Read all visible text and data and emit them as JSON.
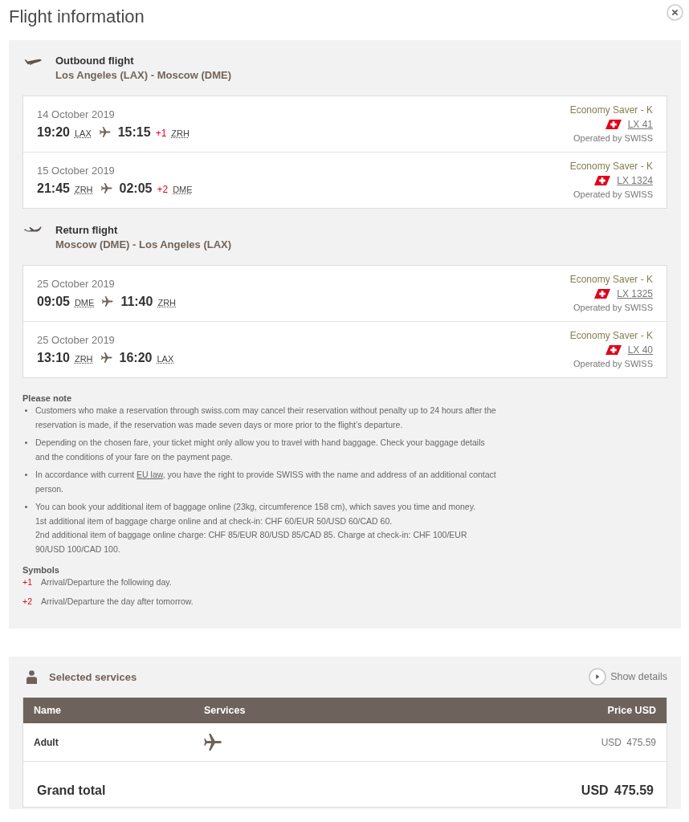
{
  "dialog": {
    "title": "Flight information"
  },
  "journeys": [
    {
      "kind": "outbound",
      "heading": "Outbound flight",
      "route": "Los Angeles (LAX) - Moscow (DME)",
      "segments": [
        {
          "date": "14 October 2019",
          "departure_time": "19:20",
          "departure_airport": "LAX",
          "arrival_time": "15:15",
          "day_offset": "+1",
          "arrival_airport": "ZRH",
          "fare": "Economy Saver - K",
          "flight_number": "LX 41",
          "operator": "Operated by SWISS"
        },
        {
          "date": "15 October 2019",
          "departure_time": "21:45",
          "departure_airport": "ZRH",
          "arrival_time": "02:05",
          "day_offset": "+2",
          "arrival_airport": "DME",
          "fare": "Economy Saver - K",
          "flight_number": "LX 1324",
          "operator": "Operated by SWISS"
        }
      ]
    },
    {
      "kind": "return",
      "heading": "Return flight",
      "route": "Moscow (DME) - Los Angeles (LAX)",
      "segments": [
        {
          "date": "25 October 2019",
          "departure_time": "09:05",
          "departure_airport": "DME",
          "arrival_time": "11:40",
          "arrival_airport": "ZRH",
          "fare": "Economy Saver - K",
          "flight_number": "LX 1325",
          "operator": "Operated by SWISS"
        },
        {
          "date": "25 October 2019",
          "departure_time": "13:10",
          "departure_airport": "ZRH",
          "arrival_time": "16:20",
          "arrival_airport": "LAX",
          "fare": "Economy Saver - K",
          "flight_number": "LX 40",
          "operator": "Operated by SWISS"
        }
      ]
    }
  ],
  "notes": {
    "heading": "Please note",
    "items": [
      {
        "paragraphs": [
          [
            {
              "kind": "text",
              "text": "Customers who make a reservation through swiss.com may cancel their reservation without penalty up to 24 hours after the reservation is made, if the reservation was made seven days or more prior to the flight’s departure."
            }
          ]
        ]
      },
      {
        "paragraphs": [
          [
            {
              "kind": "text",
              "text": "Depending on the chosen fare, your ticket might only allow you to travel with hand baggage. Check your baggage details and the conditions of your fare on the payment page."
            }
          ]
        ]
      },
      {
        "paragraphs": [
          [
            {
              "kind": "text",
              "text": "In accordance with current "
            },
            {
              "kind": "link",
              "text": "EU law"
            },
            {
              "kind": "text",
              "text": ", you have the right to provide SWISS with the name and address of an additional contact person."
            }
          ]
        ]
      },
      {
        "paragraphs": [
          [
            {
              "kind": "text",
              "text": "You can book your additional item of baggage online (23kg, circumference 158 cm), which saves you time and money."
            }
          ],
          [
            {
              "kind": "text",
              "text": "1st additional item of baggage charge online and at check-in: CHF 60/EUR 50/USD 60/CAD 60."
            }
          ],
          [
            {
              "kind": "text",
              "text": "2nd additional item of baggage online charge: CHF 85/EUR 80/USD 85/CAD 85. Charge at check-in: CHF 100/EUR 90/USD 100/CAD 100."
            }
          ]
        ]
      }
    ]
  },
  "symbols": {
    "heading": "Symbols",
    "items": [
      {
        "symbol": "+1",
        "text": "Arrival/Departure the following day."
      },
      {
        "symbol": "+2",
        "text": "Arrival/Departure the day after tomorrow."
      }
    ]
  },
  "services": {
    "heading": "Selected services",
    "toggle": "Show details",
    "table": {
      "columns": [
        "Name",
        "Services",
        "Price USD"
      ],
      "rows": [
        {
          "name": "Adult",
          "price": "USD 475.59"
        }
      ]
    },
    "grand_total": {
      "label": "Grand total",
      "amount": "USD 475.59"
    }
  }
}
